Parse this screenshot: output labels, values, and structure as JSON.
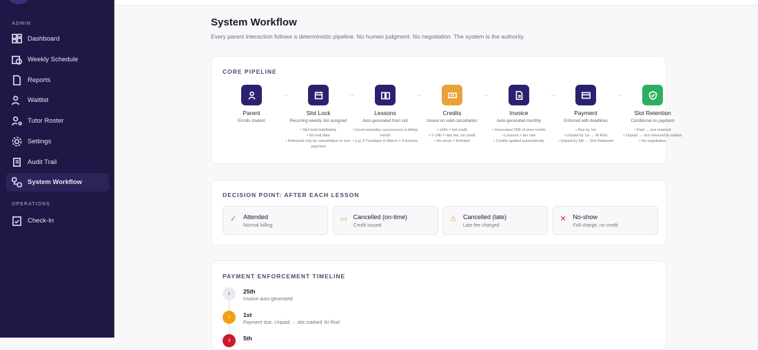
{
  "sidebar": {
    "admin_label": "ADMIN",
    "ops_label": "OPERATIONS",
    "items": [
      {
        "label": "Dashboard"
      },
      {
        "label": "Weekly Schedule"
      },
      {
        "label": "Reports"
      },
      {
        "label": "Waitlist"
      },
      {
        "label": "Tutor Roster"
      },
      {
        "label": "Settings"
      },
      {
        "label": "Audit Trail"
      },
      {
        "label": "System Workflow"
      }
    ],
    "ops_items": [
      {
        "label": "Check-In"
      }
    ]
  },
  "page": {
    "title": "System Workflow",
    "subtitle": "Every parent interaction follows a deterministic pipeline. No human judgment. No negotiation. The system is the authority."
  },
  "pipeline": {
    "heading": "CORE PIPELINE",
    "steps": [
      {
        "name": "Parent",
        "desc": "Enrolls student",
        "bullets": [],
        "color": "#2a2270"
      },
      {
        "name": "Slot Lock",
        "desc": "Recurring weekly slot assigned",
        "bullets": [
          "• Slot held indefinitely",
          "• No end date",
          "• Released only by cancellation or non-payment"
        ],
        "color": "#2a2270"
      },
      {
        "name": "Lessons",
        "desc": "Auto-generated from slot",
        "bullets": [
          "• Count weekday occurrences in billing month",
          "• e.g. 4 Tuesdays in March = 4 lessons"
        ],
        "color": "#2a2270"
      },
      {
        "name": "Credits",
        "desc": "Issued on valid cancellation",
        "bullets": [
          "• ≥24h = full credit",
          "• 2–24h = late fee, no credit",
          "• No-show = forfeited"
        ],
        "color": "#e8a23a"
      },
      {
        "name": "Invoice",
        "desc": "Auto-generated monthly",
        "bullets": [
          "• Generated 25th of prior month",
          "• Lessons × tier rate",
          "• Credits applied automatically"
        ],
        "color": "#2a2270"
      },
      {
        "name": "Payment",
        "desc": "Enforced with deadlines",
        "bullets": [
          "• Due by 1st",
          "• Unpaid by 1st → At Risk",
          "• Unpaid by 5th → Slot Released"
        ],
        "color": "#2a2270"
      },
      {
        "name": "Slot Retention",
        "desc": "Conditional on payment",
        "bullets": [
          "• Paid → slot retained",
          "• Unpaid → slot released to waitlist",
          "• No negotiation"
        ],
        "color": "#2fae5f"
      }
    ]
  },
  "decision": {
    "heading": "DECISION POINT: AFTER EACH LESSON",
    "items": [
      {
        "title": "Attended",
        "desc": "Normal billing",
        "icon": "✓",
        "color": "#2fae5f"
      },
      {
        "title": "Cancelled (on-time)",
        "desc": "Credit issued",
        "icon": "▭",
        "color": "#e8a23a"
      },
      {
        "title": "Cancelled (late)",
        "desc": "Late fee charged",
        "icon": "⚠",
        "color": "#e8a23a"
      },
      {
        "title": "No-show",
        "desc": "Full charge, no credit",
        "icon": "✕",
        "color": "#d0263a"
      }
    ]
  },
  "timeline": {
    "heading": "PAYMENT ENFORCEMENT TIMELINE",
    "items": [
      {
        "num": "1",
        "title": "25th",
        "desc": "Invoice auto-generated",
        "color": "#ebeaf0"
      },
      {
        "num": "2",
        "title": "1st",
        "desc": "Payment due. Unpaid → slot marked 'At Risk'",
        "color": "#f0a010"
      },
      {
        "num": "3",
        "title": "5th",
        "desc": "",
        "color": "#cc1a2a"
      }
    ]
  }
}
